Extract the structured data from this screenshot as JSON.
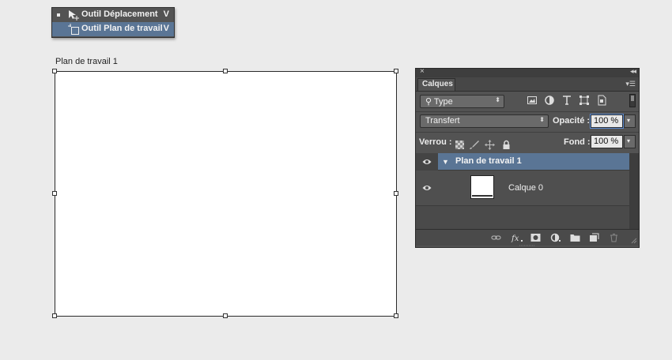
{
  "flyout": {
    "items": [
      {
        "label": "Outil Déplacement",
        "shortcut": "V",
        "icon": "move-tool-icon",
        "selected": true
      },
      {
        "label": "Outil Plan de travail",
        "shortcut": "V",
        "icon": "artboard-tool-icon",
        "highlighted": true
      }
    ]
  },
  "artboard": {
    "title": "Plan de travail 1"
  },
  "panel": {
    "tab_label": "Calques",
    "filter": {
      "kind_value": "Type",
      "icons": [
        "image-filter-icon",
        "adjustment-filter-icon",
        "type-filter-icon",
        "shape-filter-icon",
        "smart-object-filter-icon"
      ]
    },
    "blend_mode": "Transfert",
    "opacity_label": "Opacité :",
    "opacity_value": "100 %",
    "lock_label": "Verrou :",
    "fill_label": "Fond :",
    "fill_value": "100 %",
    "layers": [
      {
        "name": "Plan de travail 1",
        "type": "artboard",
        "visible": true,
        "expanded": true,
        "selected": true
      },
      {
        "name": "Calque 0",
        "type": "layer",
        "visible": true
      }
    ],
    "footer_icons": [
      "link-layers-icon",
      "fx-icon",
      "layer-mask-icon",
      "adjustment-layer-icon",
      "group-folder-icon",
      "new-layer-icon",
      "trash-icon"
    ]
  },
  "colors": {
    "panel_bg": "#535353",
    "selection": "#5a7595",
    "canvas_bg": "#ebebeb"
  }
}
